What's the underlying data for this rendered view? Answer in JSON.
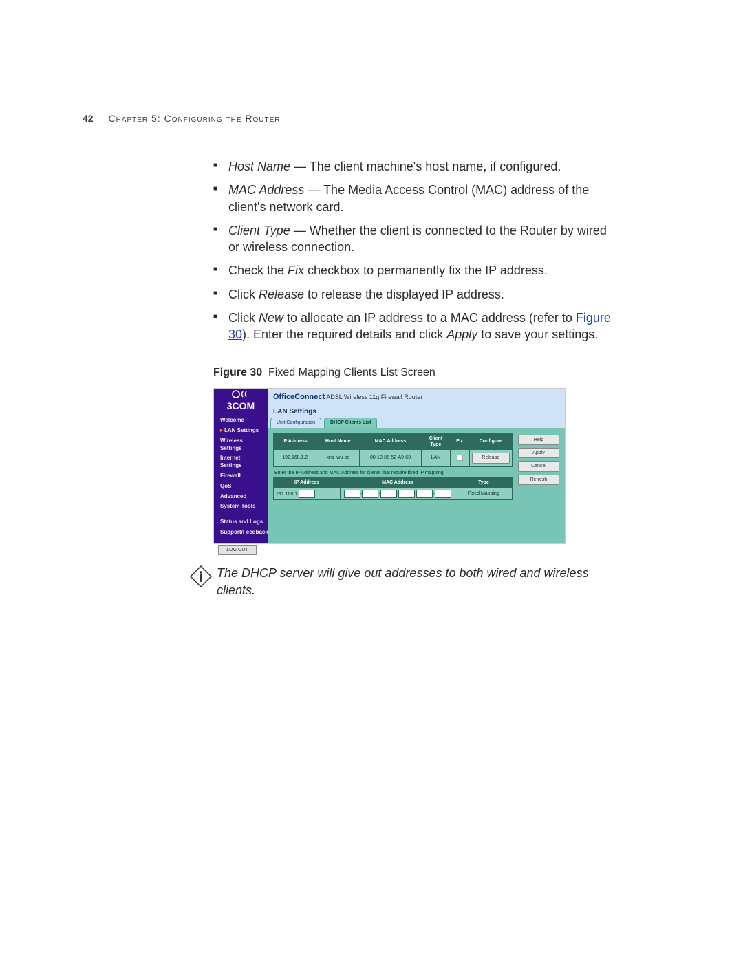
{
  "header": {
    "page_number": "42",
    "chapter": "Chapter 5: Configuring the Router"
  },
  "bullets": [
    {
      "term": "Host Name",
      "term_style": "it",
      "dash": " — ",
      "rest": "The client machine's host name, if configured."
    },
    {
      "term": "MAC Address",
      "term_style": "it",
      "dash": " — ",
      "rest": "The Media Access Control (MAC) address of the client's network card."
    },
    {
      "term": "Client Type",
      "term_style": "it",
      "dash": " — ",
      "rest": "Whether the client is connected to the Router by wired or wireless connection."
    },
    {
      "pre": "Check the ",
      "it": "Fix",
      "post": " checkbox to permanently fix the IP address."
    },
    {
      "pre": "Click ",
      "it": "Release",
      "post": " to release the displayed IP address."
    },
    {
      "pre": "Click ",
      "it": "New",
      "post": " to allocate an IP address to a MAC address (refer to ",
      "link": "Figure 30",
      "post2": "). Enter the required details and click ",
      "it2": "Apply",
      "post3": " to save your settings."
    }
  ],
  "figure": {
    "label": "Figure 30",
    "caption": "Fixed Mapping Clients List Screen"
  },
  "shot": {
    "brand": "3COM",
    "product_bold": "OfficeConnect",
    "product_rest": " ADSL Wireless 11g Firewall Router",
    "section": "LAN Settings",
    "tabs": {
      "unit": "Unit Configuration",
      "clients": "DHCP Clients List"
    },
    "nav": {
      "welcome": "Welcome",
      "lan": "LAN Settings",
      "wireless": "Wireless Settings",
      "internet": "Internet Settings",
      "firewall": "Firewall",
      "qos": "QoS",
      "advanced": "Advanced",
      "system": "System Tools",
      "status": "Status and Logs",
      "support": "Support/Feedback",
      "logout": "LOG OUT"
    },
    "table1": {
      "headers": {
        "ip": "IP Address",
        "host": "Host Name",
        "mac": "MAC Address",
        "ctype": "Client Type",
        "fix": "Fix",
        "conf": "Configure"
      },
      "row": {
        "ip": "192.168.1.2",
        "host": "kris_wu-pc",
        "mac": "00-10-85-52-A9-69",
        "ctype": "LAN",
        "release": "Release"
      }
    },
    "note": "Enter the IP Address and MAC Address for clients that require fixed IP mapping.",
    "table2": {
      "headers": {
        "ip": "IP Address",
        "mac": "MAC Address",
        "type": "Type"
      },
      "row": {
        "ip_prefix": "192.168.1.",
        "type": "Fixed Mapping"
      }
    },
    "buttons": {
      "help": "Help",
      "apply": "Apply",
      "cancel": "Cancel",
      "refresh": "Refresh"
    }
  },
  "info_note": "The DHCP server will give out addresses to both wired and wireless clients."
}
